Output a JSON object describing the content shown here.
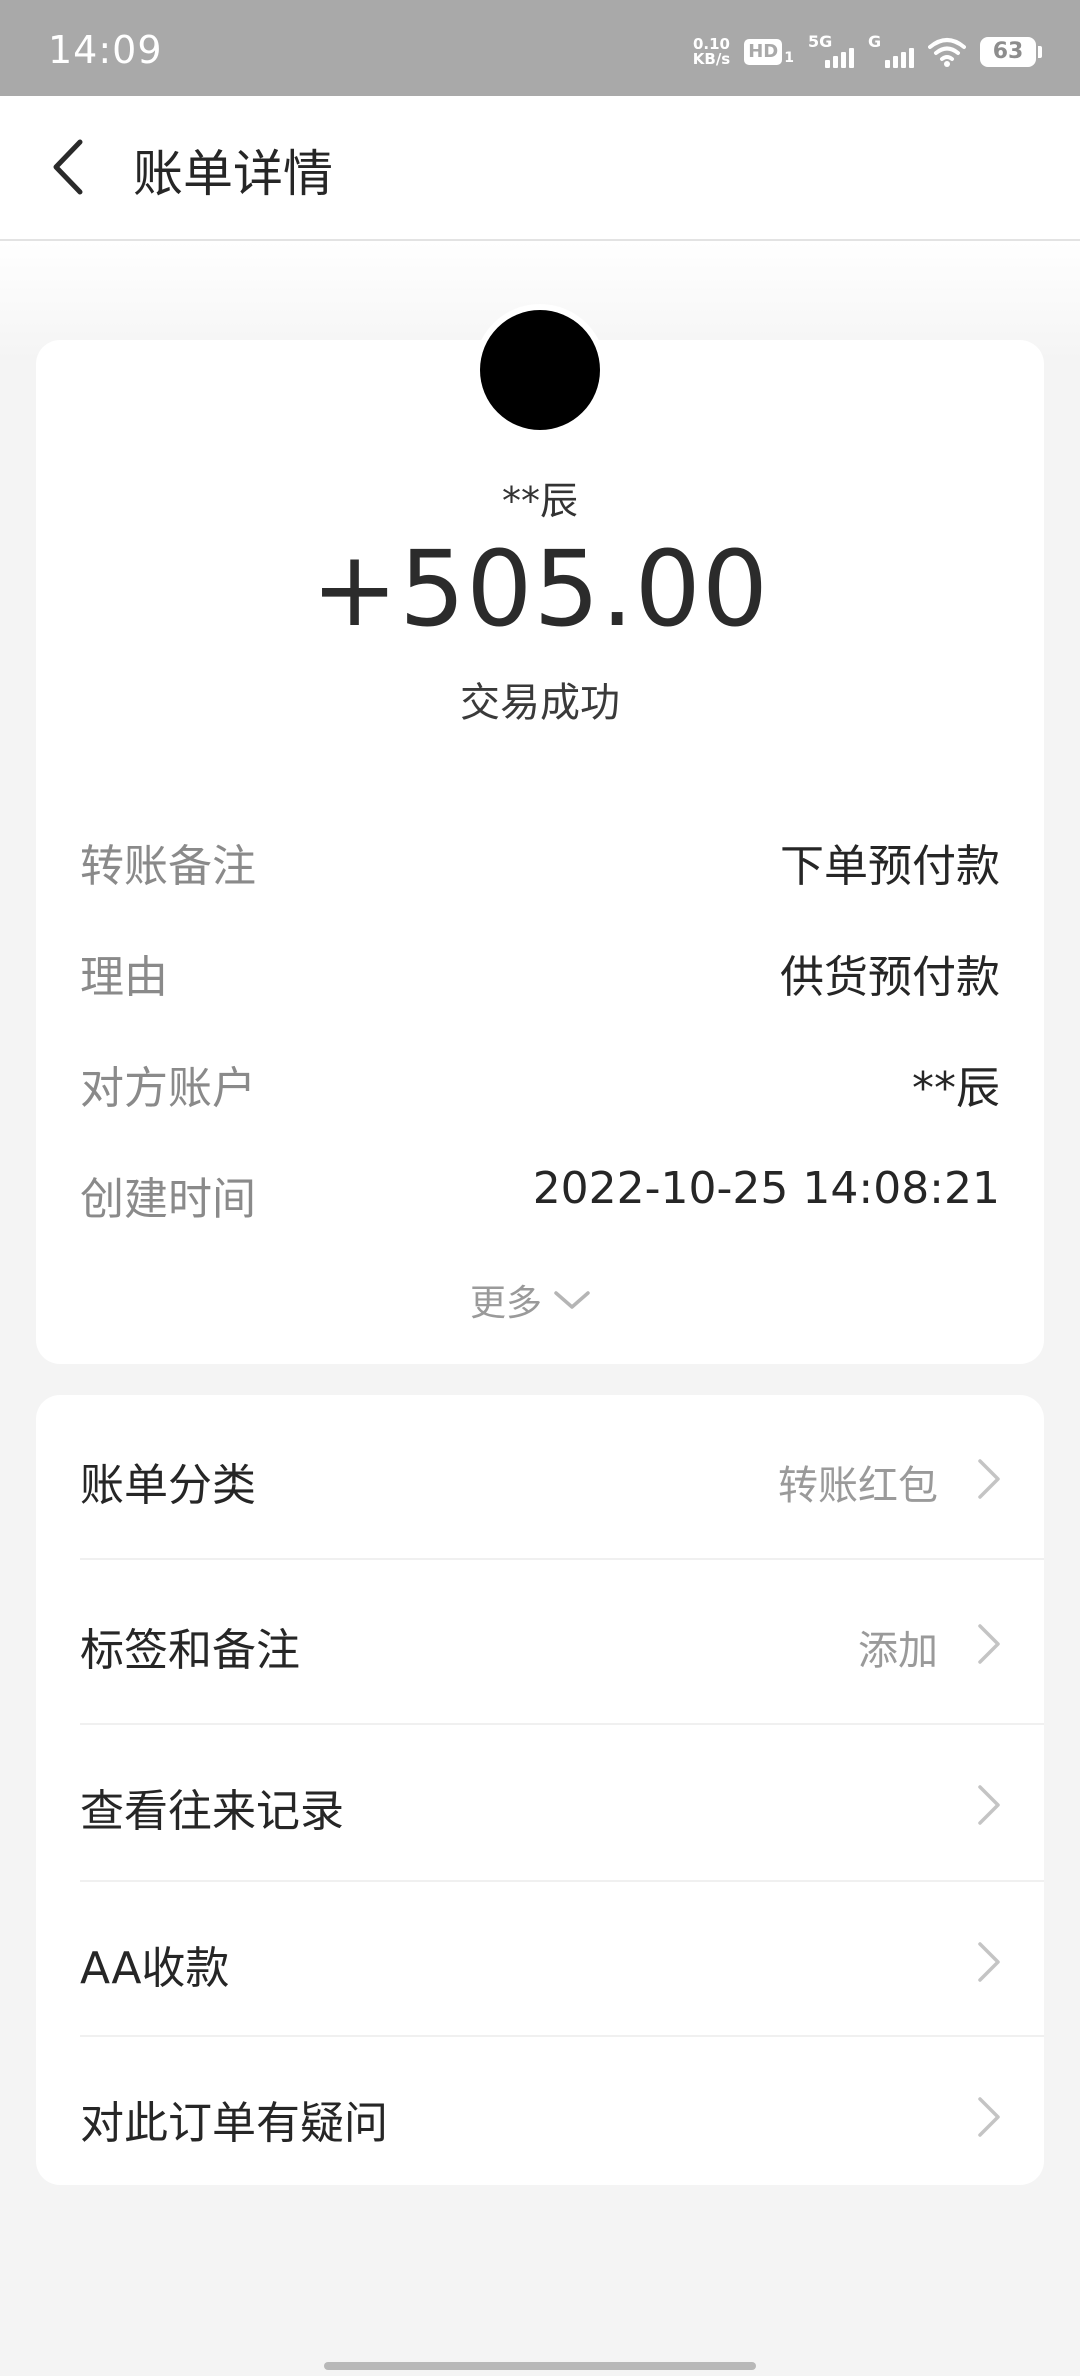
{
  "status_bar": {
    "time": "14:09",
    "net_speed_value": "0.10",
    "net_speed_unit": "KB/s",
    "hd_label": "HD",
    "hd_sub": "1",
    "sim1_label": "5G",
    "sim2_label": "G",
    "battery_level": "63"
  },
  "header": {
    "title": "账单详情"
  },
  "transaction": {
    "payer_name": "**辰",
    "amount": "+505.00",
    "status": "交易成功"
  },
  "details": [
    {
      "label": "转账备注",
      "value": "下单预付款"
    },
    {
      "label": "理由",
      "value": "供货预付款"
    },
    {
      "label": "对方账户",
      "value": "**辰"
    },
    {
      "label": "创建时间",
      "value": "2022-10-25 14:08:21"
    }
  ],
  "more_label": "更多",
  "actions": [
    {
      "label": "账单分类",
      "value": "转账红包"
    },
    {
      "label": "标签和备注",
      "value": "添加"
    },
    {
      "label": "查看往来记录",
      "value": ""
    },
    {
      "label": "AA收款",
      "value": ""
    },
    {
      "label": "对此订单有疑问",
      "value": ""
    }
  ],
  "colors": {
    "status_bar_bg": "#a9a9a9",
    "page_bg": "#f4f4f4",
    "card_bg": "#ffffff",
    "muted_text": "#8a8a8a"
  }
}
